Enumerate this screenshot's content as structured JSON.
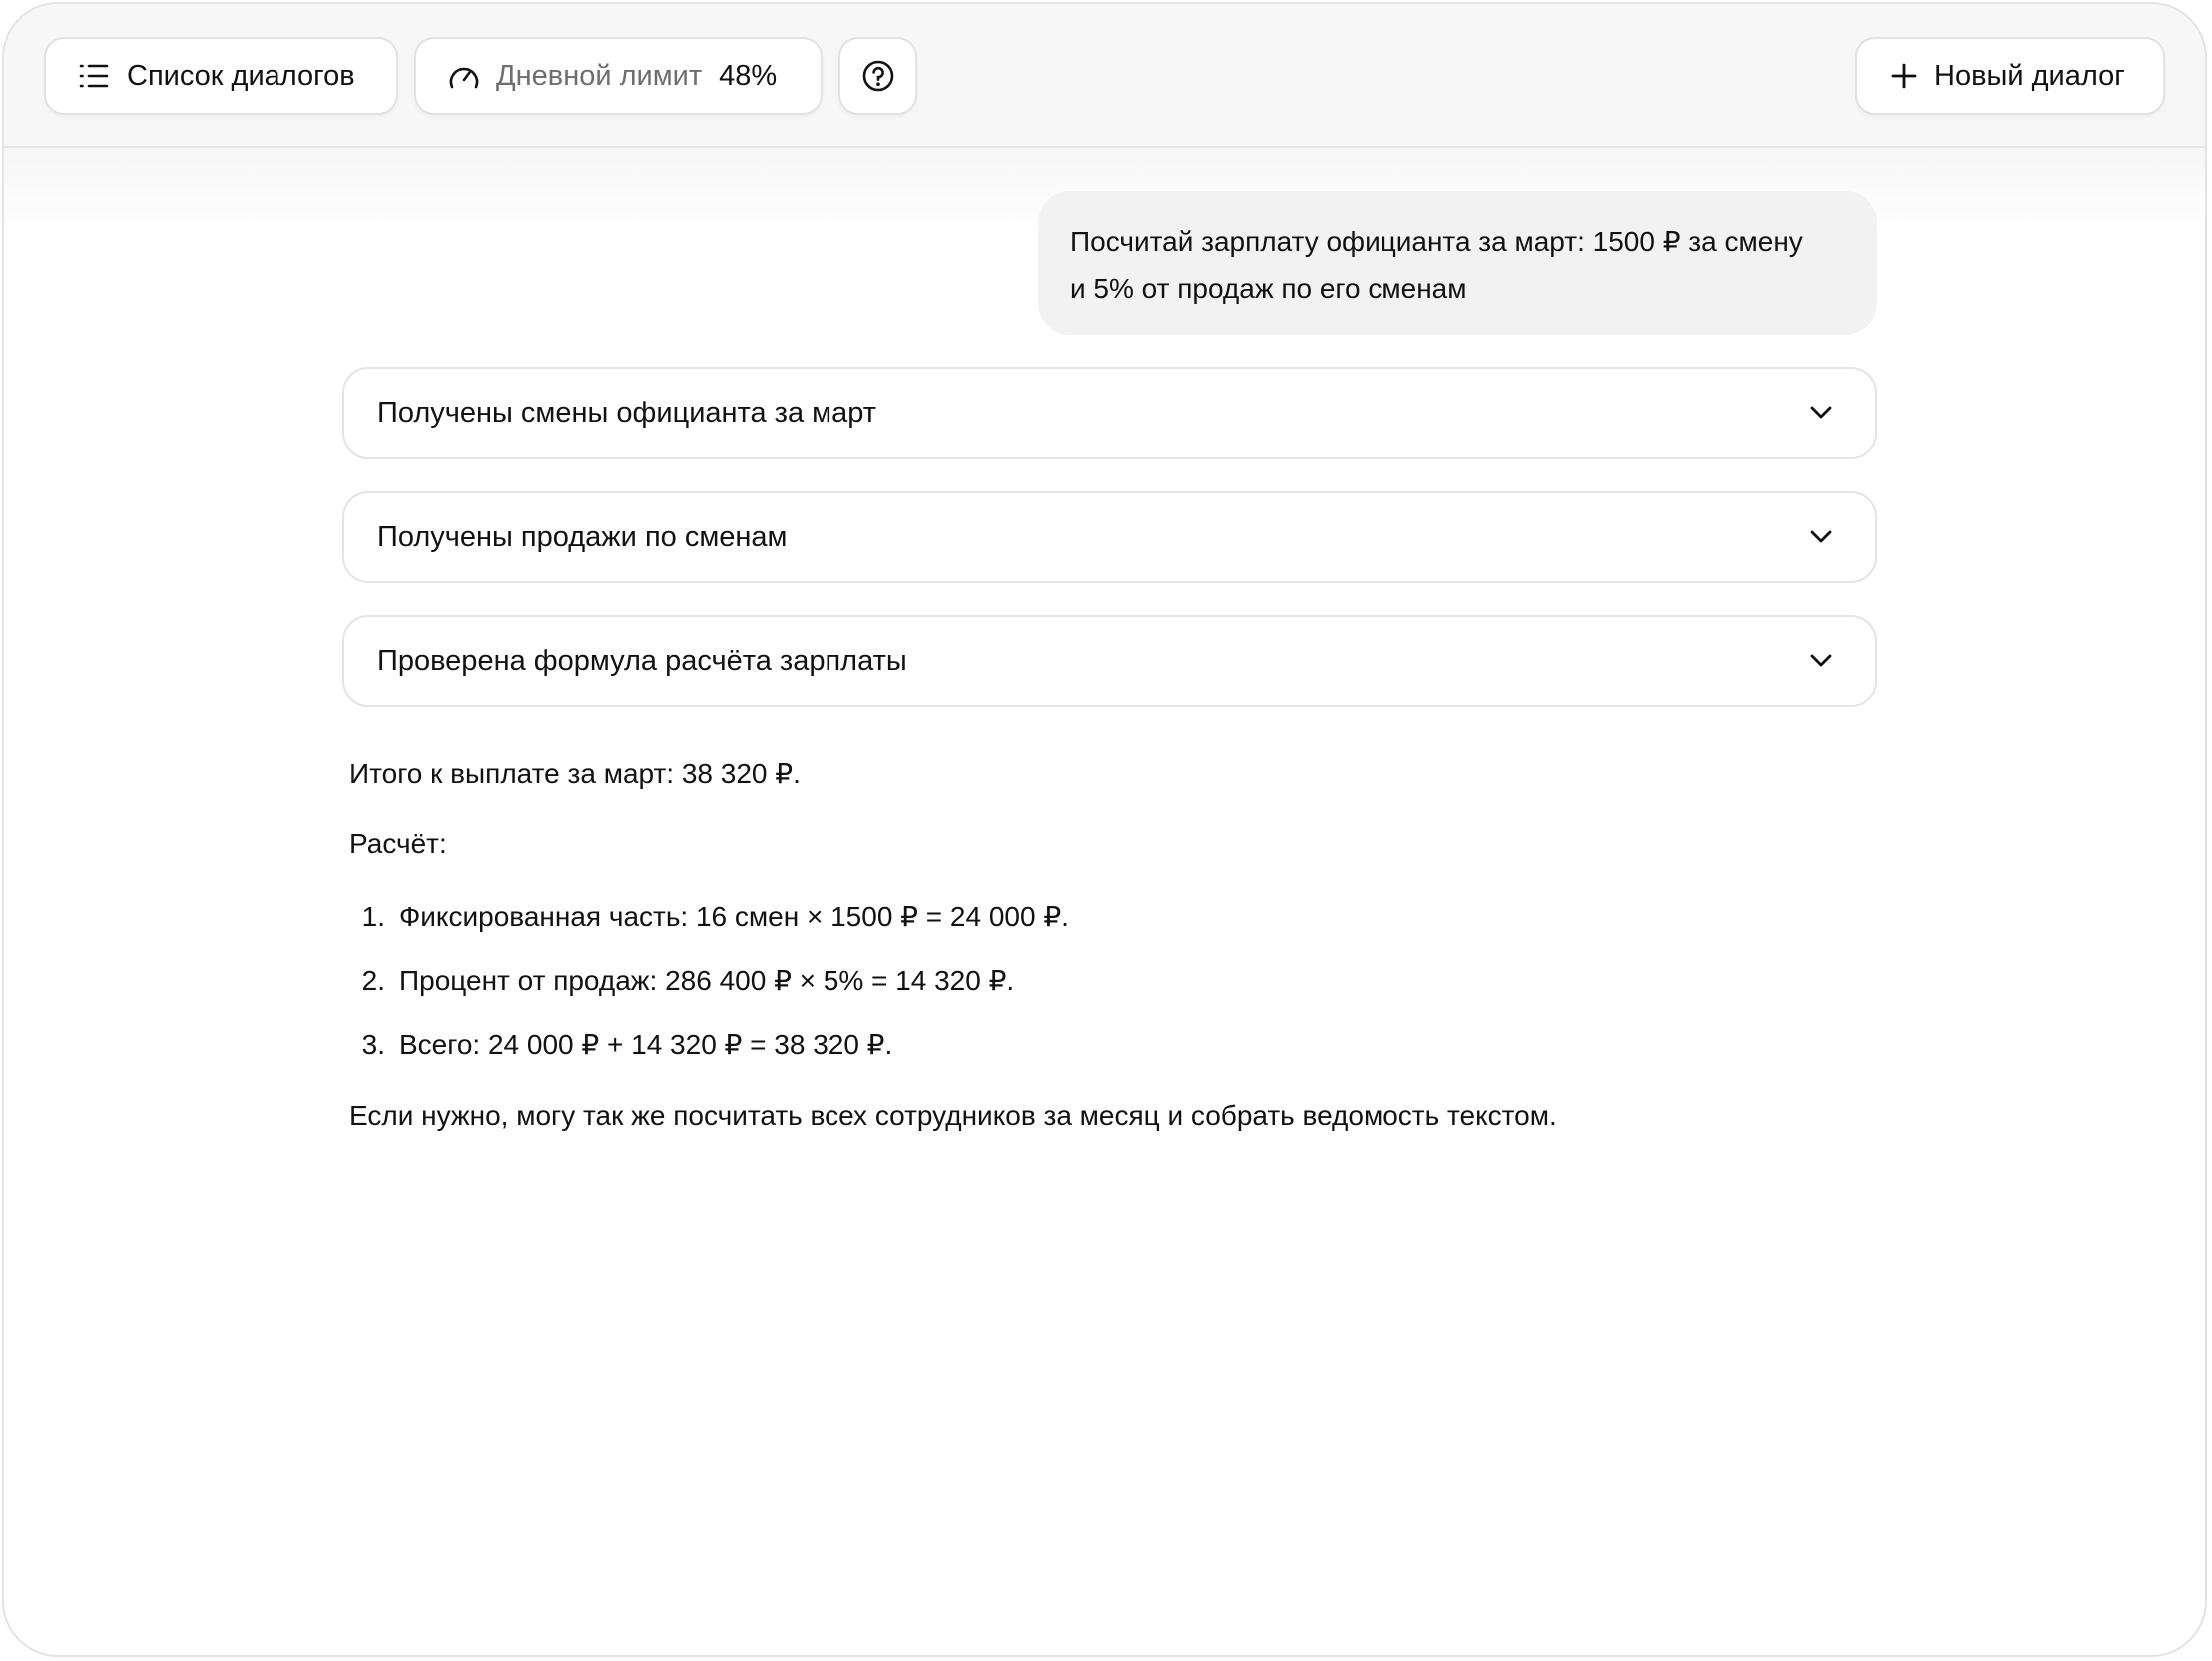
{
  "toolbar": {
    "dialogs_label": "Список диалогов",
    "limit_label": "Дневной лимит",
    "limit_value": "48%",
    "new_dialog_label": "Новый диалог"
  },
  "icons": {
    "dialogs": "list-icon",
    "limit": "gauge-icon",
    "help": "question-circle-icon",
    "new_dialog": "plus-icon",
    "step_toggle": "chevron-down-icon"
  },
  "conversation": {
    "user_message_line1": "Посчитай зарплату официанта за март: 1500 ₽ за смену",
    "user_message_line2": "и 5% от продаж по его сменам",
    "steps": [
      {
        "title": "Получены смены официанта за март"
      },
      {
        "title": "Получены продажи по сменам"
      },
      {
        "title": "Проверена формула расчёта зарплаты"
      }
    ],
    "answer": {
      "total": "Итого к выплате за март: 38 320 ₽.",
      "calc_heading": "Расчёт:",
      "items": [
        {
          "num": "1.",
          "text": "Фиксированная часть: 16 смен × 1500 ₽ = 24 000 ₽."
        },
        {
          "num": "2.",
          "text": "Процент от продаж: 286 400 ₽ × 5% = 14 320 ₽."
        },
        {
          "num": "3.",
          "text": "Всего: 24 000 ₽ + 14 320 ₽ = 38 320 ₽."
        }
      ],
      "closing": "Если нужно, могу так же посчитать всех сотрудников за месяц и собрать ведомость текстом."
    }
  }
}
